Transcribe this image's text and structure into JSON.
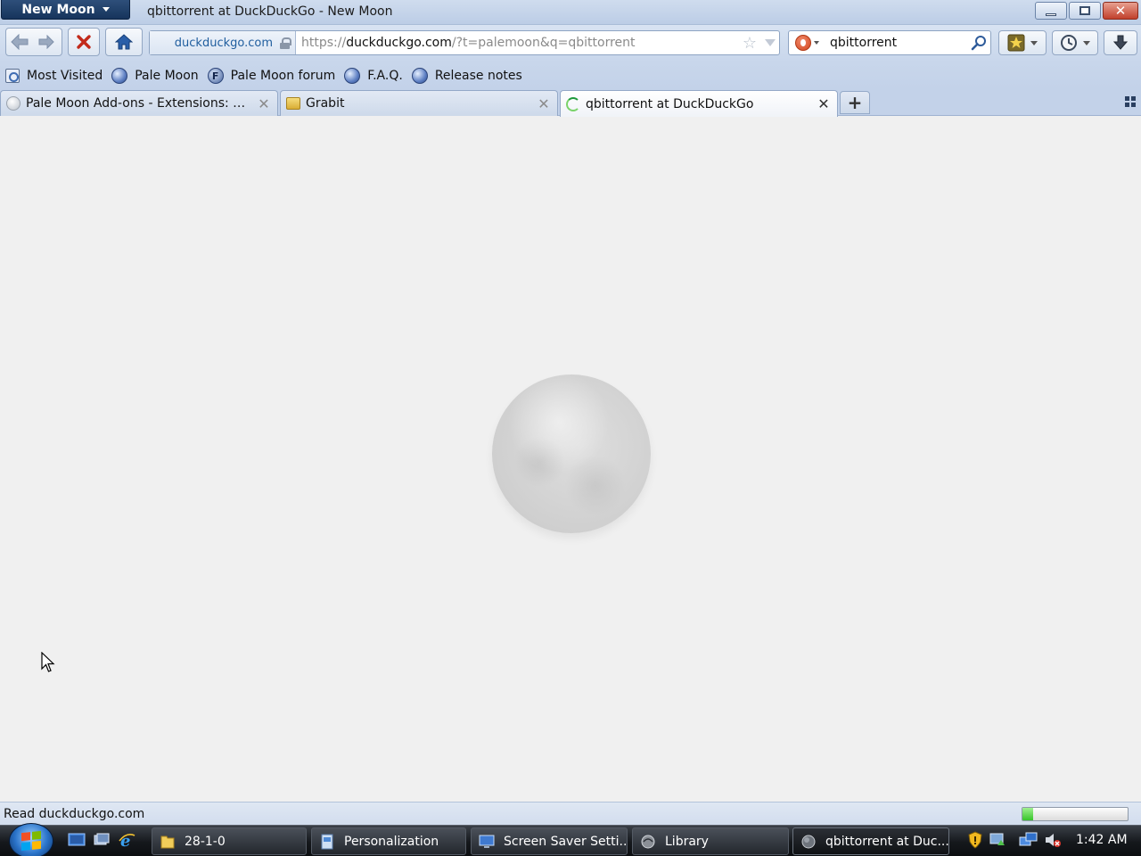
{
  "window": {
    "app_menu_label": "New Moon",
    "title": "qbittorrent at DuckDuckGo - New Moon"
  },
  "navbar": {
    "identity_host": "duckduckgo.com",
    "url_prefix": "https://",
    "url_host": "duckduckgo.com",
    "url_rest": "/?t=palemoon&q=qbittorrent",
    "search_value": "qbittorrent"
  },
  "bookmarks": [
    {
      "label": "Most Visited",
      "icon": "most-visited-icon"
    },
    {
      "label": "Pale Moon",
      "icon": "globe-icon"
    },
    {
      "label": "Pale Moon forum",
      "icon": "forum-icon"
    },
    {
      "label": "F.A.Q.",
      "icon": "globe-icon"
    },
    {
      "label": "Release notes",
      "icon": "globe-icon"
    }
  ],
  "tabs": [
    {
      "label": "Pale Moon Add-ons - Extensions: Do...",
      "icon": "moon-favicon",
      "active": false
    },
    {
      "label": "Grabit",
      "icon": "folder-favicon",
      "active": false
    },
    {
      "label": "qbittorrent at DuckDuckGo",
      "icon": "loading-spinner-icon",
      "active": true
    }
  ],
  "status": {
    "text": "Read duckduckgo.com",
    "progress_fraction": 0.1
  },
  "taskbar": {
    "items": [
      {
        "label": "28-1-0",
        "icon": "folder-icon"
      },
      {
        "label": "Personalization",
        "icon": "control-panel-icon"
      },
      {
        "label": "Screen Saver Setti...",
        "icon": "display-settings-icon"
      },
      {
        "label": "Library",
        "icon": "library-icon"
      },
      {
        "label": "qbittorrent at Duc...",
        "icon": "browser-icon"
      }
    ],
    "clock": "1:42 AM"
  },
  "colors": {
    "chrome_blue": "#c8d6eb",
    "content_bg": "#f0f0f0",
    "app_menu_bg": "#16345c",
    "close_red": "#c1402c"
  }
}
